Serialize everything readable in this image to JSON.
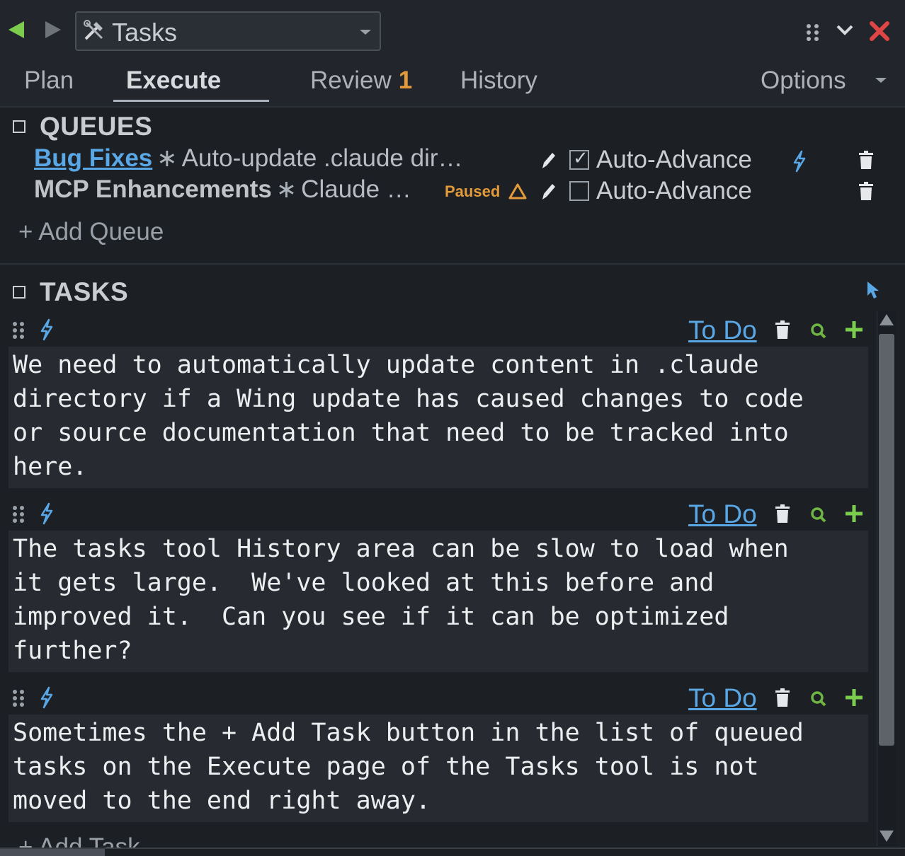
{
  "window": {
    "tool_name": "Tasks",
    "close_color": "#e04646",
    "back_color": "#7ccd4e"
  },
  "tabs": [
    {
      "label": "Plan",
      "active": false
    },
    {
      "label": "Execute",
      "active": true
    },
    {
      "label": "Review",
      "badge": "1",
      "active": false
    },
    {
      "label": "History",
      "active": false
    },
    {
      "label": "Options",
      "active": false
    }
  ],
  "queues": {
    "title": "QUEUES",
    "items": [
      {
        "name": "Bug Fixes",
        "task": "Auto-update .claude dir…",
        "status": "",
        "auto_advance_label": "Auto-Advance",
        "auto_advance_checked": true
      },
      {
        "name": "MCP Enhancements",
        "task": "Claude …",
        "status": "Paused",
        "auto_advance_label": "Auto-Advance",
        "auto_advance_checked": false
      }
    ],
    "add_label": "+ Add Queue"
  },
  "tasks": {
    "title": "TASKS",
    "items": [
      {
        "status": "To Do",
        "text": "We need to automatically update content in .claude\ndirectory if a Wing update has caused changes to code\nor source documentation that need to be tracked into\nhere."
      },
      {
        "status": "To Do",
        "text": "The tasks tool History area can be slow to load when\nit gets large.  We've looked at this before and\nimproved it.  Can you see if it can be optimized\nfurther?"
      },
      {
        "status": "To Do",
        "text": "Sometimes the + Add Task button in the list of queued\ntasks on the Execute page of the Tasks tool is not\nmoved to the end right away."
      }
    ],
    "add_label": "+ Add Task"
  },
  "colors": {
    "link": "#5aa7e6",
    "warning": "#e29a3a",
    "plus": "#7ccd4e",
    "background": "#1c1f24"
  }
}
